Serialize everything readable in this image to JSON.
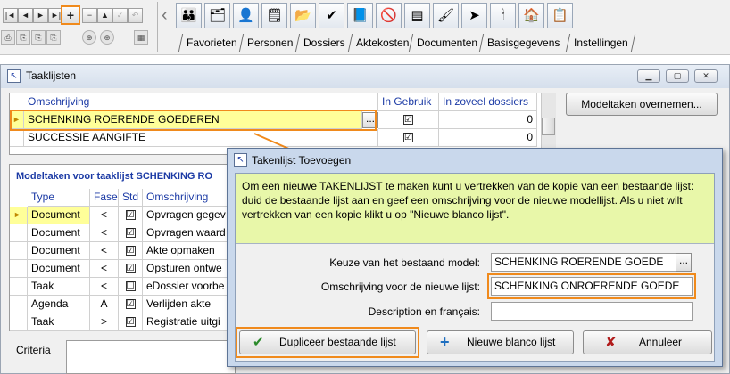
{
  "toolbar": {
    "nav_buttons": [
      "|◄",
      "◄",
      "►",
      "►|",
      "+",
      "−",
      "▲",
      "✓",
      "↶"
    ],
    "small_icons": [
      "⎙",
      "⎘",
      "⎘",
      "⎘",
      "⊕",
      "⊕",
      "▦"
    ],
    "big_icons": [
      "👪",
      "🗂",
      "👤",
      "🗒",
      "📂",
      "✔",
      "📘",
      "🚫",
      "▤",
      "🖌",
      "➤",
      "🕯",
      "🏠",
      "📋"
    ],
    "tabs": [
      "Favorieten",
      "Personen",
      "Dossiers",
      "Aktekosten",
      "Documenten",
      "Basisgegevens",
      "Instellingen"
    ]
  },
  "window": {
    "title": "Taaklijsten",
    "modeltaken_button": "Modeltaken overnemen...",
    "lists_grid": {
      "headers": [
        "Omschrijving",
        "In Gebruik",
        "In zoveel dossiers"
      ],
      "rows": [
        {
          "name": "SCHENKING ROERENDE GOEDEREN",
          "count": "0",
          "in_use": "☑"
        },
        {
          "name": "SUCCESSIE AANGIFTE",
          "count": "0",
          "in_use": "☑"
        }
      ],
      "ellipsis": "..."
    },
    "tasks_title": "Modeltaken voor taaklijst SCHENKING RO",
    "tasks_grid": {
      "headers": [
        "Type",
        "Fase",
        "Std",
        "Omschrijving"
      ],
      "rows": [
        {
          "type": "Document",
          "fase": "<",
          "std": "☑",
          "omschrijving": "Opvragen gegev"
        },
        {
          "type": "Document",
          "fase": "<",
          "std": "☑",
          "omschrijving": "Opvragen waard"
        },
        {
          "type": "Document",
          "fase": "<",
          "std": "☑",
          "omschrijving": "Akte opmaken"
        },
        {
          "type": "Document",
          "fase": "<",
          "std": "☑",
          "omschrijving": "Opsturen ontwe"
        },
        {
          "type": "Taak",
          "fase": "<",
          "std": "☐",
          "omschrijving": "eDossier voorbe"
        },
        {
          "type": "Agenda",
          "fase": "A",
          "std": "☑",
          "omschrijving": "Verlijden akte"
        },
        {
          "type": "Taak",
          "fase": ">",
          "std": "☑",
          "omschrijving": "Registratie uitgi"
        }
      ]
    },
    "criteria_label": "Criteria"
  },
  "dialog": {
    "title": "Takenlijst Toevoegen",
    "description": "Om een nieuwe TAKENLIJST te maken kunt u vertrekken van de kopie van een bestaande lijst:  duid de bestaande lijst aan en geef een omschrijving voor de nieuwe modellijst.  Als u niet wilt vertrekken van een kopie klikt u op \"Nieuwe blanco lijst\".",
    "model_label": "Keuze van het bestaand model:",
    "model_value": "SCHENKING ROERENDE GOEDE",
    "model_ellipsis": "...",
    "new_desc_label": "Omschrijving voor de nieuwe lijst:",
    "new_desc_value": "SCHENKING ONROERENDE GOEDE",
    "french_label": "Description en français:",
    "french_value": "",
    "buttons": {
      "duplicate": "Dupliceer bestaande lijst",
      "duplicate_icon": "✔",
      "blank": "Nieuwe blanco lijst",
      "blank_icon": "+",
      "cancel": "Annuleer",
      "cancel_icon": "✘"
    }
  },
  "colors": {
    "highlight": "#f08a1c",
    "selected_row": "#ffff99",
    "description_bg": "#e8f7a9",
    "header_text": "#1b3aa5"
  }
}
